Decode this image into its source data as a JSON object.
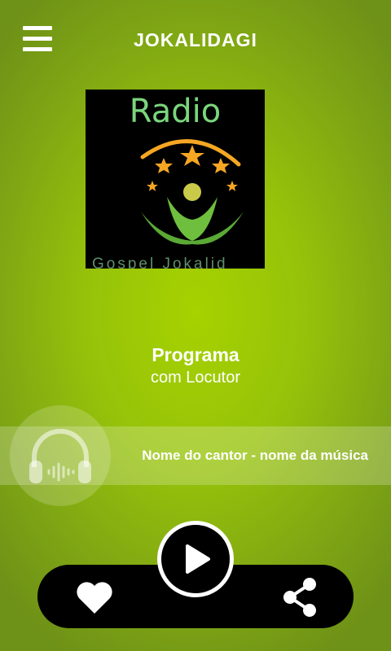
{
  "header": {
    "title": "JOKALIDAGI",
    "menu_icon": "hamburger-menu-icon"
  },
  "cover": {
    "radio_text": "Radio",
    "station_text": "Gospel Jokalid",
    "logo_icon": "stars-person-logo"
  },
  "program": {
    "title": "Programa",
    "subtitle": "com Locutor"
  },
  "now_playing": {
    "track": "Nome do cantor - nome da música",
    "icon": "headphones-icon"
  },
  "controls": {
    "like_icon": "heart-icon",
    "play_icon": "play-icon",
    "share_icon": "share-icon"
  },
  "colors": {
    "background": "#96c20a",
    "text": "#ffffff",
    "player_bar": "#000000",
    "logo_green": "#7ad67c",
    "logo_orange": "#f5a623"
  }
}
